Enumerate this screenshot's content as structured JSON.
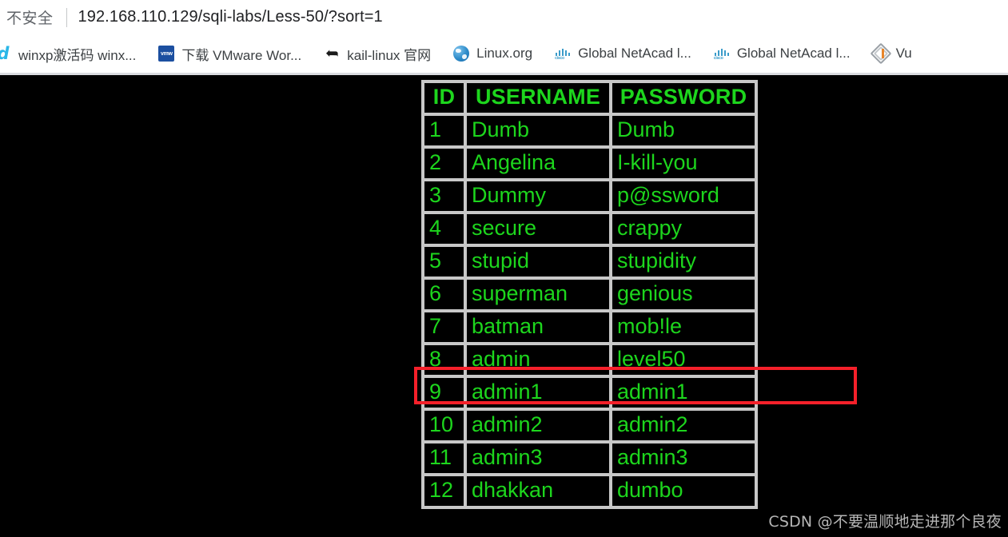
{
  "browser": {
    "security_label": "不安全",
    "url": "192.168.110.129/sqli-labs/Less-50/?sort=1",
    "bookmarks": [
      {
        "label": "winxp激活码 winx...",
        "icon": "baidu-icon"
      },
      {
        "label": "下载 VMware Wor...",
        "icon": "vmware-icon"
      },
      {
        "label": "kail-linux 官网",
        "icon": "kali-dragon-icon"
      },
      {
        "label": "Linux.org",
        "icon": "globe-icon"
      },
      {
        "label": "Global NetAcad l...",
        "icon": "cisco-icon"
      },
      {
        "label": "Global NetAcad l...",
        "icon": "cisco-icon"
      },
      {
        "label": "Vu",
        "icon": "vulnhub-diamond-icon"
      }
    ]
  },
  "page": {
    "background_color": "#000000",
    "text_color": "#1dd61d",
    "border_color": "#c8c8c8",
    "highlight_color": "#f5202a",
    "table": {
      "columns": [
        "ID",
        "USERNAME",
        "PASSWORD"
      ],
      "rows": [
        {
          "id": "1",
          "username": "Dumb",
          "password": "Dumb"
        },
        {
          "id": "2",
          "username": "Angelina",
          "password": "I-kill-you"
        },
        {
          "id": "3",
          "username": "Dummy",
          "password": "p@ssword"
        },
        {
          "id": "4",
          "username": "secure",
          "password": "crappy"
        },
        {
          "id": "5",
          "username": "stupid",
          "password": "stupidity"
        },
        {
          "id": "6",
          "username": "superman",
          "password": "genious"
        },
        {
          "id": "7",
          "username": "batman",
          "password": "mob!le"
        },
        {
          "id": "8",
          "username": "admin",
          "password": "level50"
        },
        {
          "id": "9",
          "username": "admin1",
          "password": "admin1"
        },
        {
          "id": "10",
          "username": "admin2",
          "password": "admin2"
        },
        {
          "id": "11",
          "username": "admin3",
          "password": "admin3"
        },
        {
          "id": "12",
          "username": "dhakkan",
          "password": "dumbo"
        }
      ],
      "highlighted_row_id": "8"
    },
    "watermark": "CSDN @不要温顺地走进那个良夜"
  }
}
